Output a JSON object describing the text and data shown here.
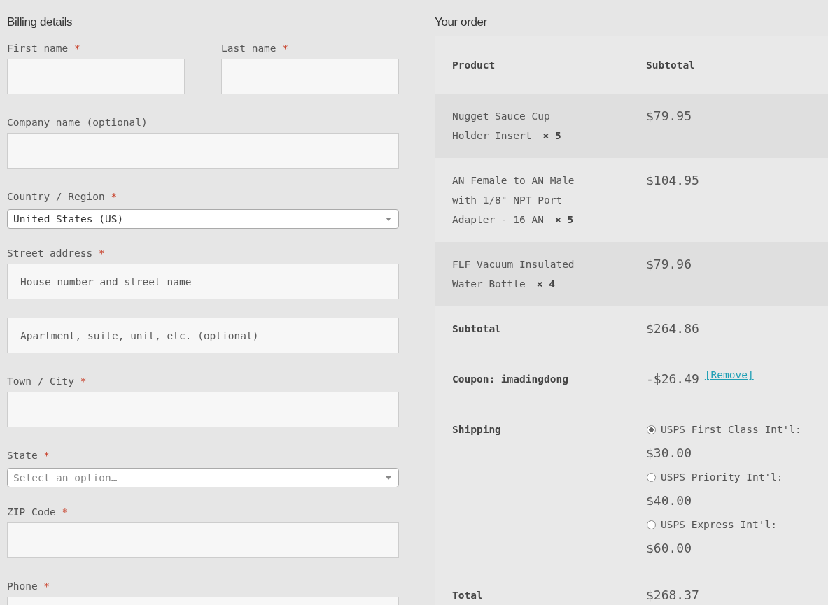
{
  "billing": {
    "title": "Billing details",
    "rows": [
      [
        {
          "label": "First name",
          "required_mark": "*",
          "inputs": [
            {
              "kind": "text"
            }
          ]
        },
        {
          "label": "Last name",
          "required_mark": "*",
          "inputs": [
            {
              "kind": "text"
            }
          ]
        }
      ],
      [
        {
          "label": "Company name (optional)",
          "inputs": [
            {
              "kind": "text"
            }
          ]
        }
      ],
      [
        {
          "label": "Country / Region",
          "required_mark": "*",
          "inputs": [
            {
              "kind": "select",
              "value": "United States (US)"
            }
          ]
        }
      ],
      [
        {
          "label": "Street address",
          "required_mark": "*",
          "inputs": [
            {
              "kind": "text",
              "placeholder": "House number and street name"
            },
            {
              "kind": "text",
              "placeholder": "Apartment, suite, unit, etc. (optional)"
            }
          ]
        }
      ],
      [
        {
          "label": "Town / City",
          "required_mark": "*",
          "inputs": [
            {
              "kind": "text"
            }
          ]
        }
      ],
      [
        {
          "label": "State",
          "required_mark": "*",
          "inputs": [
            {
              "kind": "select",
              "placeholder": "Select an option…"
            }
          ]
        }
      ],
      [
        {
          "label": "ZIP Code",
          "required_mark": "*",
          "inputs": [
            {
              "kind": "text"
            }
          ]
        }
      ],
      [
        {
          "label": "Phone",
          "required_mark": "*",
          "inputs": [
            {
              "kind": "text"
            }
          ]
        }
      ]
    ]
  },
  "order": {
    "title": "Your order",
    "columns": [
      "Product",
      "Subtotal"
    ],
    "items": [
      {
        "name": "Nugget Sauce Cup Holder Insert",
        "quantity": "× 5",
        "subtotal": "$79.95"
      },
      {
        "name": "AN Female to AN Male with 1/8\" NPT Port Adapter - 16 AN",
        "quantity": "× 5",
        "subtotal": "$104.95"
      },
      {
        "name": "FLF Vacuum Insulated Water Bottle",
        "quantity": "× 4",
        "subtotal": "$79.96"
      }
    ],
    "totals": [
      {
        "kind": "amount",
        "label": "Subtotal",
        "value": "$264.86"
      },
      {
        "kind": "coupon",
        "label": "Coupon: imadingdong",
        "value": "-$26.49",
        "link": "[Remove]"
      },
      {
        "kind": "shipping",
        "label": "Shipping",
        "options": [
          {
            "label": "USPS First Class Int'l:",
            "price": "$30.00",
            "selected": true
          },
          {
            "label": "USPS Priority Int'l:",
            "price": "$40.00",
            "selected": false
          },
          {
            "label": "USPS Express Int'l:",
            "price": "$60.00",
            "selected": false
          }
        ]
      },
      {
        "kind": "amount",
        "label": "Total",
        "value": "$268.37"
      }
    ]
  }
}
